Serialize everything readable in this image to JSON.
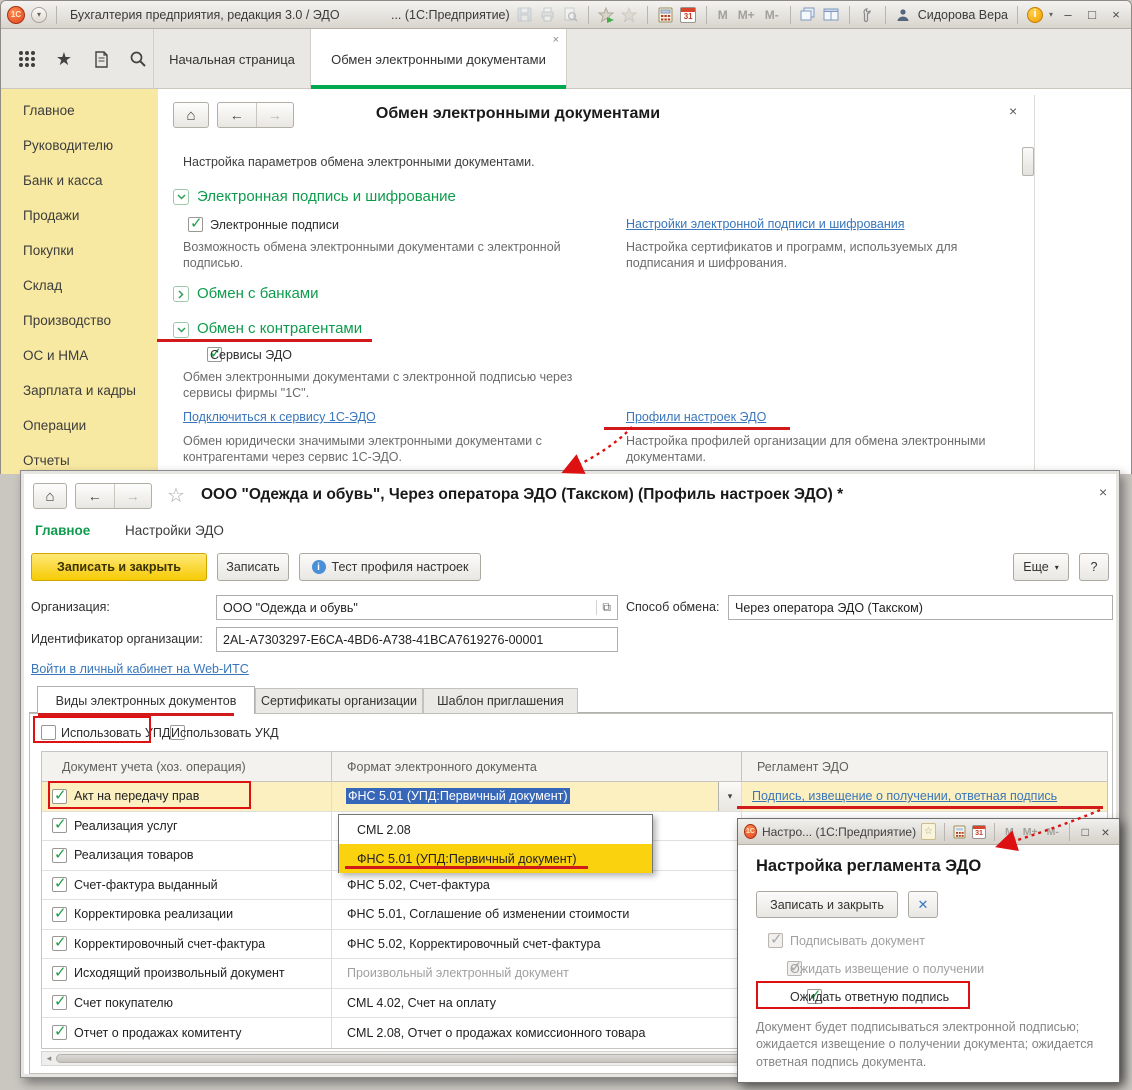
{
  "app": {
    "logo": "1С",
    "title": "Бухгалтерия предприятия, редакция 3.0 / ЭДО",
    "title_suffix": "... (1С:Предприятие)",
    "user_name": "Сидорова Вера",
    "mem": [
      "M",
      "M+",
      "M-"
    ]
  },
  "icons": {
    "home": "⌂",
    "back": "←",
    "forward": "→",
    "star": "★",
    "star_outline": "☆",
    "close": "×",
    "dropdown_arrow": "▾",
    "left_scroll_arrow": "◂",
    "help": "?",
    "minimize": "–",
    "maximize": "□",
    "open_picker": "⧉",
    "calendar_day": "31",
    "blue_cross": "✕",
    "search": "magnifier-icon",
    "menu_grid": "grid-icon",
    "history": "history-icon",
    "wrench": "wrench-icon",
    "user": "person-icon",
    "info": "info-icon"
  },
  "tabs": {
    "home_tab": "Начальная страница",
    "active_tab": "Обмен электронными документами"
  },
  "sidebar": {
    "items": [
      "Главное",
      "Руководителю",
      "Банк и касса",
      "Продажи",
      "Покупки",
      "Склад",
      "Производство",
      "ОС и НМА",
      "Зарплата и кадры",
      "Операции",
      "Отчеты"
    ]
  },
  "edx": {
    "title": "Обмен электронными документами",
    "intro": "Настройка параметров обмена электронными документами.",
    "sec_signature": {
      "title": "Электронная подпись и шифрование",
      "cb_label": "Электронные подписи",
      "desc": "Возможность обмена электронными документами с электронной подписью.",
      "link": "Настройки электронной подписи и шифрования",
      "link_desc": "Настройка сертификатов и программ, используемых для подписания и шифрования."
    },
    "sec_banks": {
      "title": "Обмен с банками"
    },
    "sec_partners": {
      "title": "Обмен с контрагентами",
      "cb_label": "Сервисы ЭДО",
      "desc": "Обмен электронными документами с электронной подписью через сервисы фирмы \"1С\".",
      "link_connect": "Подключиться к сервису 1С-ЭДО",
      "connect_desc": "Обмен юридически значимыми электронными документами с контрагентами через сервис 1С-ЭДО.",
      "link_profiles": "Профили настроек ЭДО",
      "profiles_desc": "Настройка профилей организации для обмена электронными документами."
    }
  },
  "profile": {
    "title": "ООО \"Одежда и обувь\", Через оператора ЭДО (Такском) (Профиль настроек ЭДО) *",
    "menu": [
      "Главное",
      "Настройки ЭДО"
    ],
    "buttons": {
      "save_close": "Записать и закрыть",
      "save": "Записать",
      "test": "Тест профиля настроек",
      "more": "Еще",
      "help": "?"
    },
    "fields": {
      "org_label": "Организация:",
      "org_value": "ООО \"Одежда и обувь\"",
      "method_label": "Способ обмена:",
      "method_value": "Через оператора ЭДО (Такском)",
      "id_label": "Идентификатор организации:",
      "id_value": "2AL-A7303297-E6CA-4BD6-A738-41BCA7619276-00001",
      "cabinet_link": "Войти в личный кабинет на Web-ИТС"
    },
    "tabs": [
      "Виды электронных документов",
      "Сертификаты организации",
      "Шаблон приглашения"
    ],
    "use_upd": "Использовать УПД",
    "use_ukd": "Использовать УКД",
    "table": {
      "headers": [
        "Документ учета (хоз. операция)",
        "Формат электронного документа",
        "Регламент ЭДО"
      ],
      "rows": [
        {
          "doc": "Акт на передачу прав",
          "fmt": "ФНС 5.01 (УПД:Первичный документ)",
          "reg": "Подпись, извещение о получении, ответная подпись"
        },
        {
          "doc": "Реализация услуг",
          "fmt": "",
          "reg": ""
        },
        {
          "doc": "Реализация товаров",
          "fmt": "",
          "reg": ""
        },
        {
          "doc": "Счет-фактура выданный",
          "fmt": "ФНС 5.02, Счет-фактура",
          "reg": ""
        },
        {
          "doc": "Корректировка реализации",
          "fmt": "ФНС 5.01, Соглашение об изменении стоимости",
          "reg": ""
        },
        {
          "doc": "Корректировочный счет-фактура",
          "fmt": "ФНС 5.02, Корректировочный счет-фактура",
          "reg": ""
        },
        {
          "doc": "Исходящий произвольный документ",
          "fmt": "Произвольный электронный документ",
          "reg": ""
        },
        {
          "doc": "Счет покупателю",
          "fmt": "CML 4.02, Счет на оплату",
          "reg": ""
        },
        {
          "doc": "Отчет о продажах комитенту",
          "fmt": "CML 2.08, Отчет о продажах комиссионного товара",
          "reg": ""
        }
      ]
    },
    "dropdown": {
      "items": [
        "CML 2.08",
        "ФНС 5.01 (УПД:Первичный документ)"
      ],
      "selected_index": 1
    }
  },
  "regulation": {
    "window_title": "Настро... (1С:Предприятие)",
    "title": "Настройка регламента ЭДО",
    "save_close": "Записать и закрыть",
    "checkboxes": [
      {
        "label": "Подписывать документ",
        "checked": true,
        "disabled": true
      },
      {
        "label": "Ожидать извещение о получении",
        "checked": true,
        "disabled": true
      },
      {
        "label": "Ожидать ответную подпись",
        "checked": true,
        "disabled": false
      }
    ],
    "description": "Документ будет подписываться электронной подписью; ожидается извещение о получении документа; ожидается ответная подпись документа."
  }
}
